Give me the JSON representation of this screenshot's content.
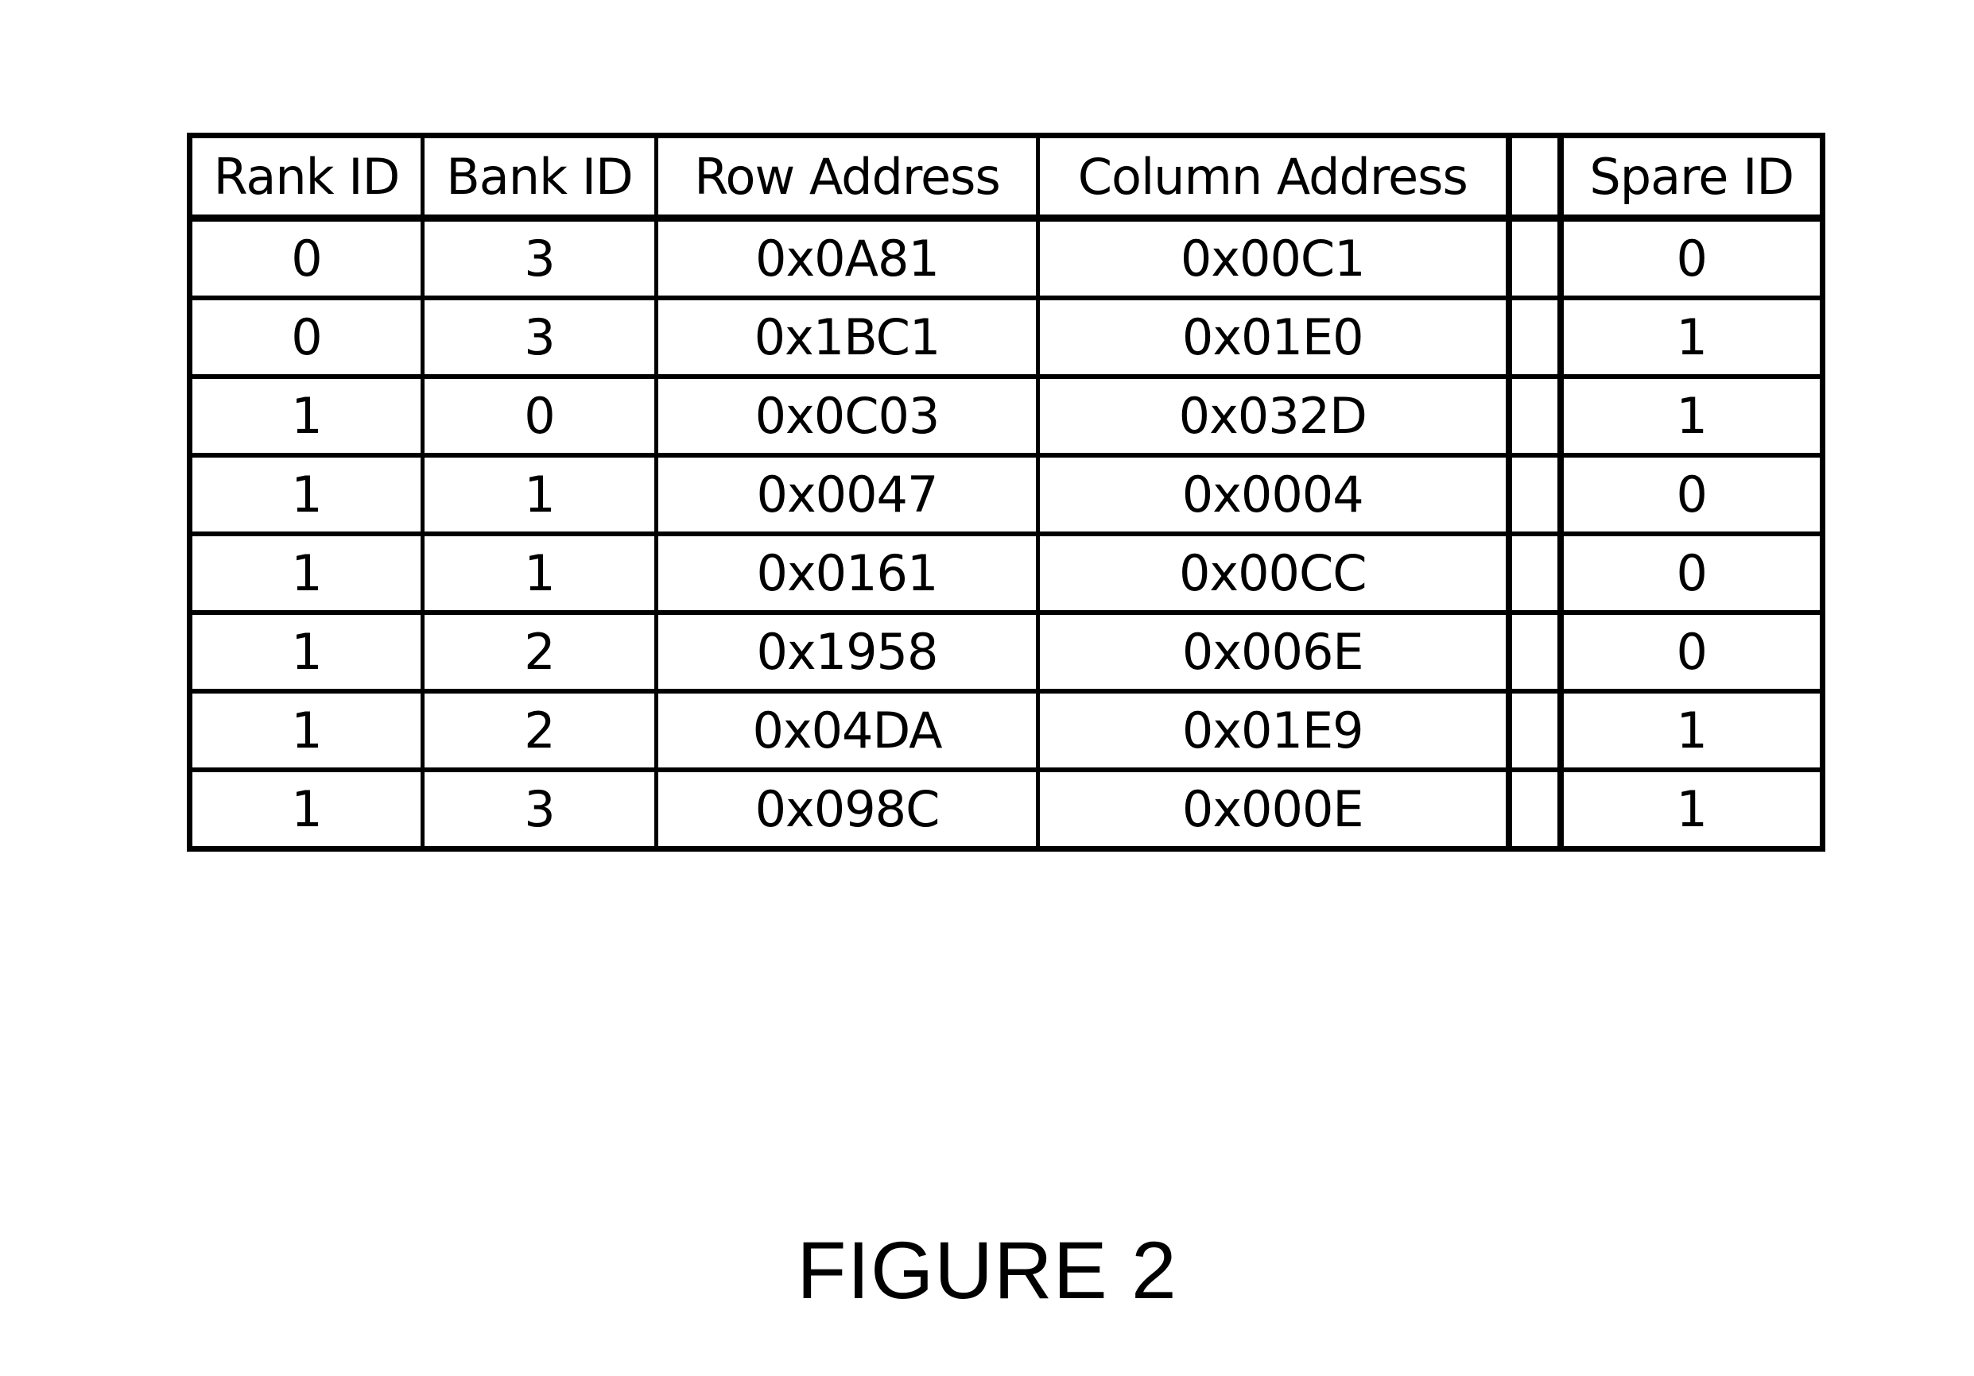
{
  "table": {
    "headers": [
      "Rank ID",
      "Bank ID",
      "Row Address",
      "Column Address",
      "",
      "Spare ID"
    ],
    "rows": [
      [
        "0",
        "3",
        "0x0A81",
        "0x00C1",
        "",
        "0"
      ],
      [
        "0",
        "3",
        "0x1BC1",
        "0x01E0",
        "",
        "1"
      ],
      [
        "1",
        "0",
        "0x0C03",
        "0x032D",
        "",
        "1"
      ],
      [
        "1",
        "1",
        "0x0047",
        "0x0004",
        "",
        "0"
      ],
      [
        "1",
        "1",
        "0x0161",
        "0x00CC",
        "",
        "0"
      ],
      [
        "1",
        "2",
        "0x1958",
        "0x006E",
        "",
        "0"
      ],
      [
        "1",
        "2",
        "0x04DA",
        "0x01E9",
        "",
        "1"
      ],
      [
        "1",
        "3",
        "0x098C",
        "0x000E",
        "",
        "1"
      ]
    ]
  },
  "caption": "FIGURE 2"
}
